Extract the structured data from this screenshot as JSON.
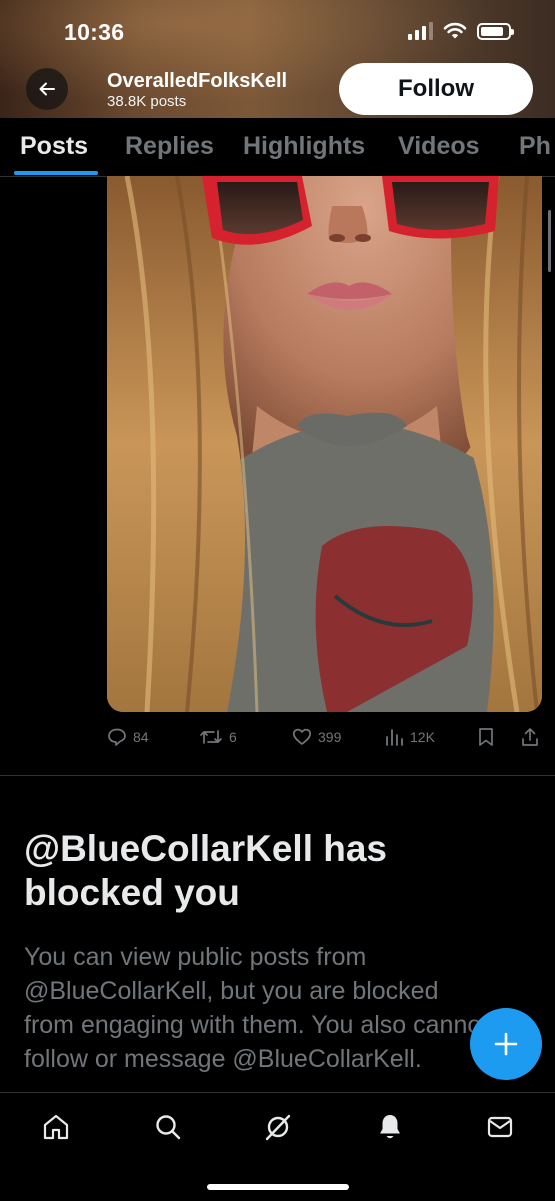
{
  "status_bar": {
    "time": "10:36"
  },
  "header": {
    "display_name": "OveralledFolksKell",
    "post_count": "38.8K posts",
    "follow_label": "Follow"
  },
  "tabs": [
    {
      "label": "Posts",
      "active": true
    },
    {
      "label": "Replies"
    },
    {
      "label": "Highlights"
    },
    {
      "label": "Videos"
    },
    {
      "label": "Ph"
    }
  ],
  "post": {
    "replies": "84",
    "reposts": "6",
    "likes": "399",
    "views": "12K"
  },
  "blocked_notice": {
    "title": "@BlueCollarKell has blocked you",
    "body": "You can view public posts from @BlueCollarKell, but you are blocked from engaging with them. You also cannot follow or message @BlueCollarKell."
  },
  "bottom_nav": [
    "home-icon",
    "search-icon",
    "grok-icon",
    "notifications-icon",
    "messages-icon"
  ],
  "colors": {
    "accent": "#1d9bf0",
    "background": "#000000",
    "secondary_text": "#71767b"
  }
}
